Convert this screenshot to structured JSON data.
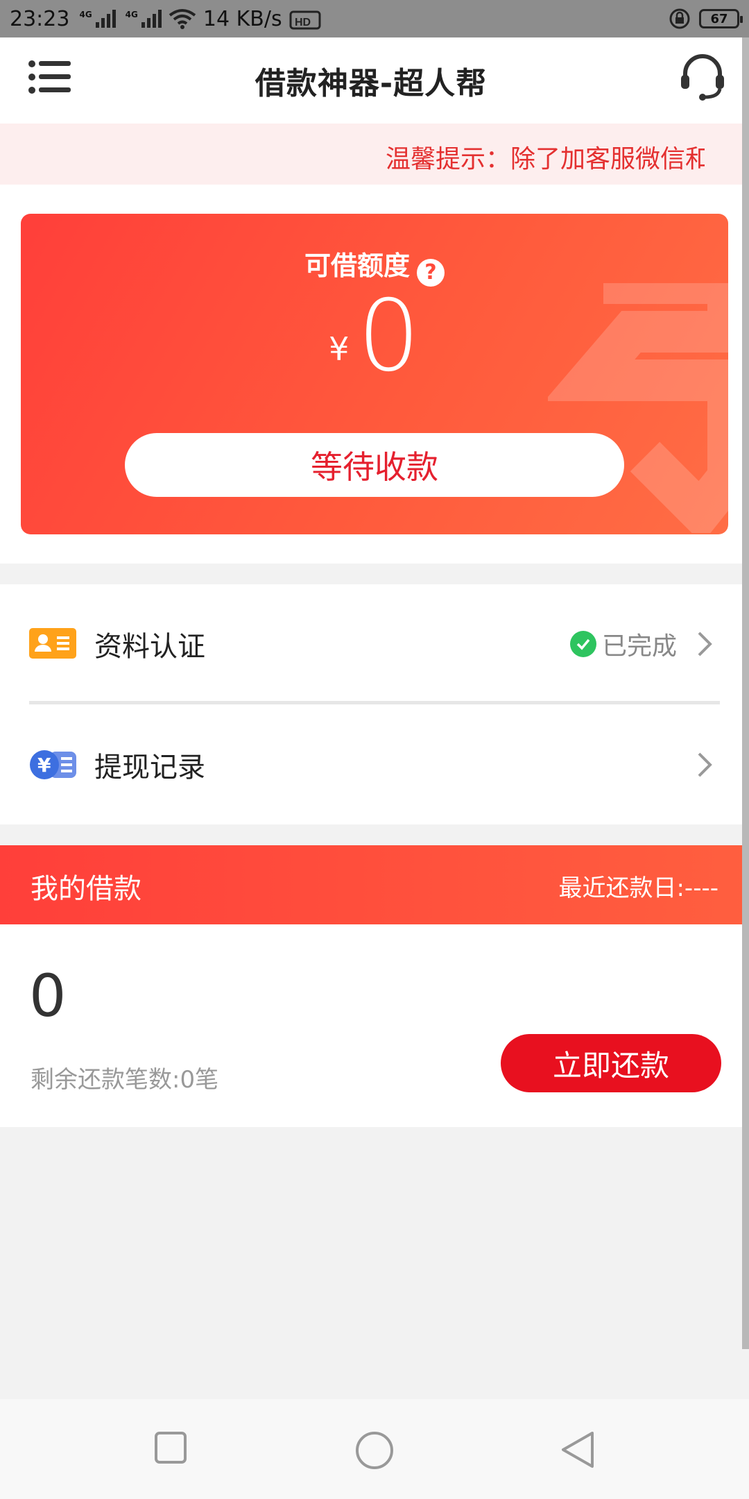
{
  "status_bar": {
    "time": "23:23",
    "net_type_1": "4G",
    "net_type_2": "4G",
    "speed": "14 KB/s",
    "battery": "67"
  },
  "header": {
    "title": "借款神器-超人帮",
    "menu_icon": "list-menu-icon",
    "support_icon": "headset-icon"
  },
  "notice": {
    "text": "温馨提示：除了加客服微信和"
  },
  "quota_card": {
    "label": "可借额度",
    "help_icon": "?",
    "currency": "¥",
    "amount": "0",
    "button_label": "等待收款"
  },
  "list": {
    "items": [
      {
        "label": "资料认证",
        "status": "已完成",
        "icon": "id-card-icon"
      },
      {
        "label": "提现记录",
        "status": "",
        "icon": "yuan-record-icon"
      }
    ]
  },
  "loan": {
    "title": "我的借款",
    "recent_date": "最近还款日:----",
    "amount": "0",
    "remaining": "剩余还款笔数:0笔",
    "repay_button": "立即还款"
  },
  "colors": {
    "brand_red": "#ff4a3a",
    "button_red": "#e8101f",
    "success_green": "#2ec45f"
  }
}
